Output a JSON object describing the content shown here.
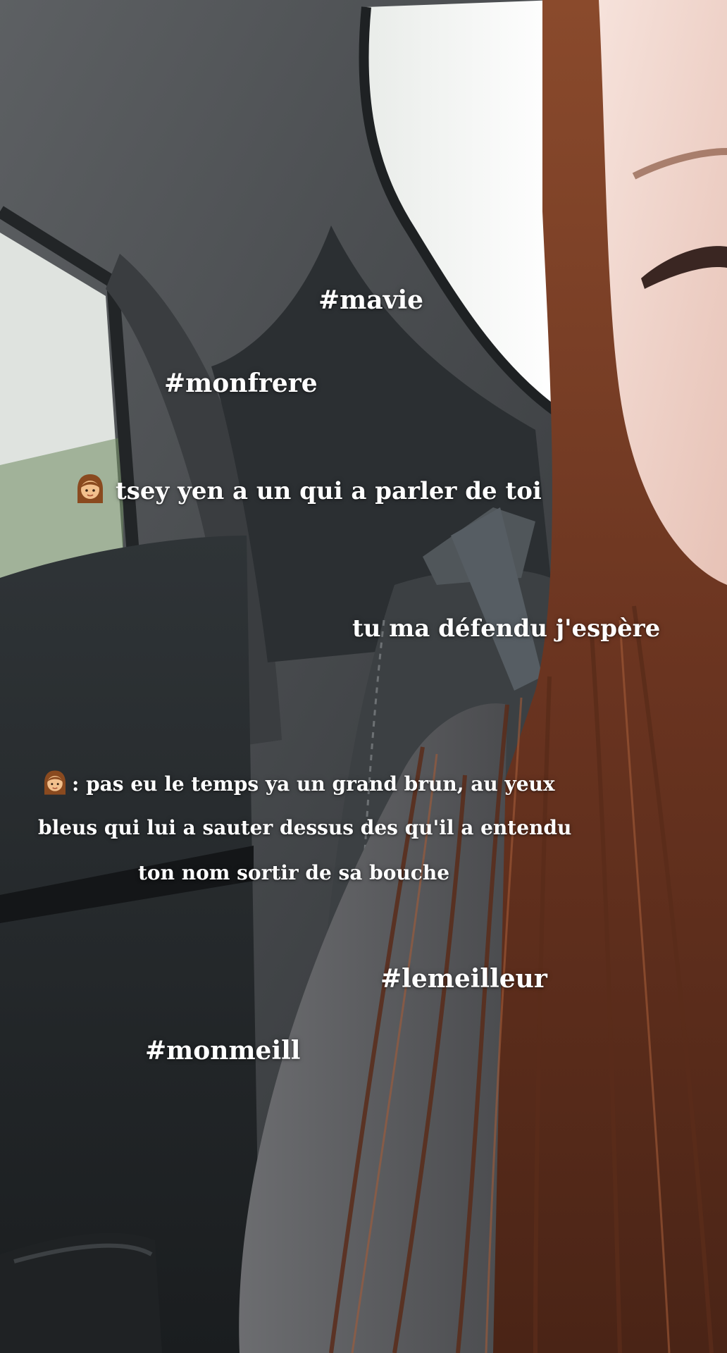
{
  "scene": {
    "description_icons": [
      "car-interior",
      "woman-emoji"
    ],
    "colors": {
      "headliner": "#4a4d50",
      "door_panel": "#24282b",
      "window_glare": "#f5f6f4",
      "hair": "#6b3520",
      "skin": "#f0d6cf",
      "shirt": "#5f6063",
      "seat": "#3c4043"
    }
  },
  "captions": {
    "tag_mavie": "#mavie",
    "tag_monfrere": "#monfrere",
    "line1_text": "tsey yen a un qui a parler de toi",
    "line2_text": "tu ma défendu j'espère",
    "line3_a": ": pas eu le temps ya un grand brun, au yeux",
    "line3_b": "bleus qui lui a sauter dessus des qu'il a entendu",
    "line3_c": "ton nom sortir de sa bouche",
    "tag_lemeilleur": "#lemeilleur",
    "tag_monmeill": "#monmeill"
  }
}
